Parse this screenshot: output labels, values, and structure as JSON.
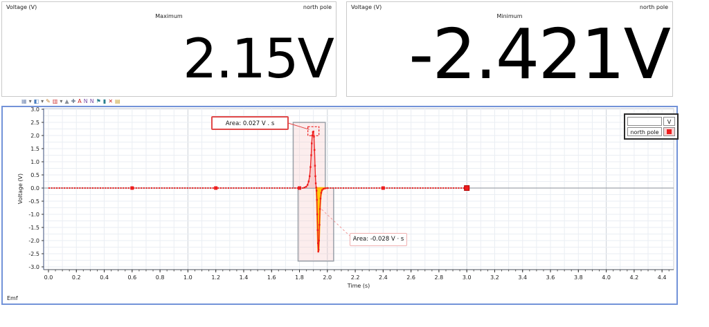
{
  "meters": [
    {
      "channel_label": "Voltage (V)",
      "series_label": "north pole",
      "stat_label": "Maximum",
      "value": "2.15V"
    },
    {
      "channel_label": "Voltage (V)",
      "series_label": "north pole",
      "stat_label": "Minimum",
      "value": "-2.421V"
    }
  ],
  "toolbar": {
    "icons": [
      {
        "name": "graph-type-icon",
        "glyph": "▦",
        "color": "#7a8fb8"
      },
      {
        "name": "dropdown-arrow-icon",
        "glyph": "▾",
        "color": "#666666"
      },
      {
        "name": "color-fill-icon",
        "glyph": "◧",
        "color": "#4a7ec0"
      },
      {
        "name": "dropdown-arrow-icon",
        "glyph": "▾",
        "color": "#666666"
      },
      {
        "name": "pencil-icon",
        "glyph": "✎",
        "color": "#c08030"
      },
      {
        "name": "magnet-icon",
        "glyph": "▥",
        "color": "#d23a3a"
      },
      {
        "name": "dropdown-arrow-icon",
        "glyph": "▾",
        "color": "#666666"
      },
      {
        "name": "autoscale-icon",
        "glyph": "▲",
        "color": "#8a8f98"
      },
      {
        "name": "pan-icon",
        "glyph": "✚",
        "color": "#6f7f95"
      },
      {
        "name": "annotate-icon",
        "glyph": "A",
        "color": "#cc2020"
      },
      {
        "name": "examine-next-icon",
        "glyph": "N",
        "color": "#7a4fa8"
      },
      {
        "name": "examine-prev-icon",
        "glyph": "N",
        "color": "#7a4fa8"
      },
      {
        "name": "flag-icon",
        "glyph": "⚑",
        "color": "#2a7f8f"
      },
      {
        "name": "stats-icon",
        "glyph": "▮",
        "color": "#2a7f8f"
      },
      {
        "name": "delete-icon",
        "glyph": "✕",
        "color": "#cc2020"
      },
      {
        "name": "note-icon",
        "glyph": "▤",
        "color": "#c8a030"
      }
    ]
  },
  "graph": {
    "footer_label": "Emf",
    "legend": {
      "input_value": "",
      "unit": "V",
      "series_name": "north pole",
      "swatch_color": "#ee1c1c"
    }
  },
  "chart_data": {
    "type": "line",
    "title": "",
    "xlabel": "Time (s)",
    "ylabel": "Voltage (V)",
    "xlim": [
      -0.04,
      4.48
    ],
    "ylim": [
      -3.0,
      3.0
    ],
    "grid": true,
    "legend_position": "top-right",
    "x_ticks": [
      0.0,
      0.2,
      0.4,
      0.6,
      0.8,
      1.0,
      1.2,
      1.4,
      1.6,
      1.8,
      2.0,
      2.2,
      2.4,
      2.6,
      2.8,
      3.0,
      3.2,
      3.4,
      3.6,
      3.8,
      4.0,
      4.2,
      4.4
    ],
    "y_ticks": [
      -3.0,
      -2.5,
      -2.0,
      -1.5,
      -1.0,
      -0.5,
      0.0,
      0.5,
      1.0,
      1.5,
      2.0,
      2.5,
      3.0
    ],
    "series": [
      {
        "name": "north pole",
        "color": "#ee1c1c",
        "baseline_value": 0,
        "flat_segments": [
          [
            0,
            1.836
          ],
          [
            2.0,
            3.0
          ]
        ],
        "spike_points": [
          [
            1.836,
            0.02
          ],
          [
            1.848,
            0.05
          ],
          [
            1.858,
            0.12
          ],
          [
            1.866,
            0.25
          ],
          [
            1.873,
            0.45
          ],
          [
            1.879,
            0.8
          ],
          [
            1.884,
            1.25
          ],
          [
            1.888,
            1.7
          ],
          [
            1.892,
            2.0
          ],
          [
            1.896,
            2.13
          ],
          [
            1.9,
            2.15
          ],
          [
            1.904,
            1.95
          ],
          [
            1.908,
            1.45
          ],
          [
            1.9115,
            0.85
          ],
          [
            1.914,
            0.45
          ],
          [
            1.917,
            0.18
          ],
          [
            1.92,
            0.02
          ],
          [
            1.9225,
            -0.1
          ],
          [
            1.925,
            -0.45
          ],
          [
            1.9275,
            -1.0
          ],
          [
            1.93,
            -1.6
          ],
          [
            1.9325,
            -2.1
          ],
          [
            1.935,
            -2.421
          ],
          [
            1.9375,
            -2.35
          ],
          [
            1.94,
            -2.0
          ],
          [
            1.9435,
            -1.4
          ],
          [
            1.947,
            -0.8
          ],
          [
            1.951,
            -0.4
          ],
          [
            1.956,
            -0.18
          ],
          [
            1.962,
            -0.08
          ],
          [
            1.972,
            -0.03
          ],
          [
            1.985,
            -0.01
          ],
          [
            2.0,
            0.0
          ]
        ],
        "peak": {
          "t": 1.9,
          "v": 2.15
        },
        "trough": {
          "t": 1.935,
          "v": -2.421
        },
        "big_marker_times": [
          0.6,
          1.2,
          1.8,
          2.4
        ],
        "end_marker_time": 3.0
      }
    ],
    "selections": [
      {
        "t0": 1.755,
        "t1": 1.985,
        "v0": 0,
        "v1": 2.5
      },
      {
        "t0": 1.79,
        "t1": 2.045,
        "v0": -2.78,
        "v1": 0
      }
    ],
    "integral_regions": [
      {
        "t0": 1.836,
        "t1": 1.92,
        "fill": "#f6c0c0",
        "area_value": 0.027
      },
      {
        "t0": 1.92,
        "t1": 1.99,
        "fill": "#ffcc00",
        "area_value": -0.028
      }
    ],
    "annotations": [
      {
        "label": "Area: 0.027 V . s"
      },
      {
        "label": "Area: -0.028 V · s"
      }
    ]
  }
}
